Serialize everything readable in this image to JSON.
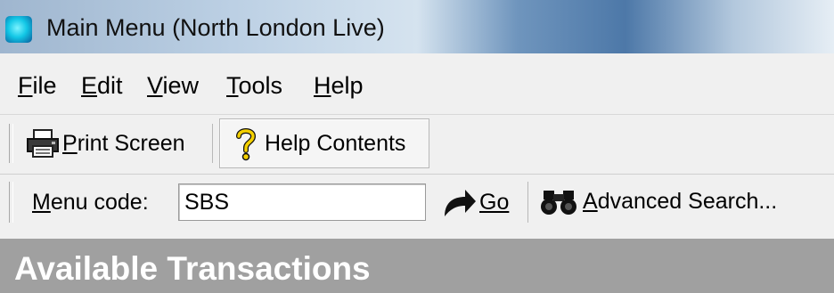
{
  "window": {
    "title": "Main Menu  (North London Live)"
  },
  "menu": {
    "items": [
      {
        "label_ul": "F",
        "label_rest": "ile"
      },
      {
        "label_ul": "E",
        "label_rest": "dit"
      },
      {
        "label_ul": "V",
        "label_rest": "iew"
      },
      {
        "label_ul": "T",
        "label_rest": "ools"
      },
      {
        "label_ul": "H",
        "label_rest": "elp"
      }
    ]
  },
  "toolbar": {
    "print_label_ul": "P",
    "print_label_rest": "rint Screen",
    "help_label": "Help Contents"
  },
  "search": {
    "menu_code_label_ul": "M",
    "menu_code_label_rest": "enu code:",
    "menu_code_value": "SBS",
    "go_label": "Go",
    "advanced_label_ul": "A",
    "advanced_label_rest": "dvanced Search..."
  },
  "section": {
    "title": "Available Transactions"
  },
  "icons": {
    "app": "app-icon",
    "print": "printer-icon",
    "help": "question-mark-icon",
    "go": "arrow-right-icon",
    "search": "binoculars-icon"
  }
}
